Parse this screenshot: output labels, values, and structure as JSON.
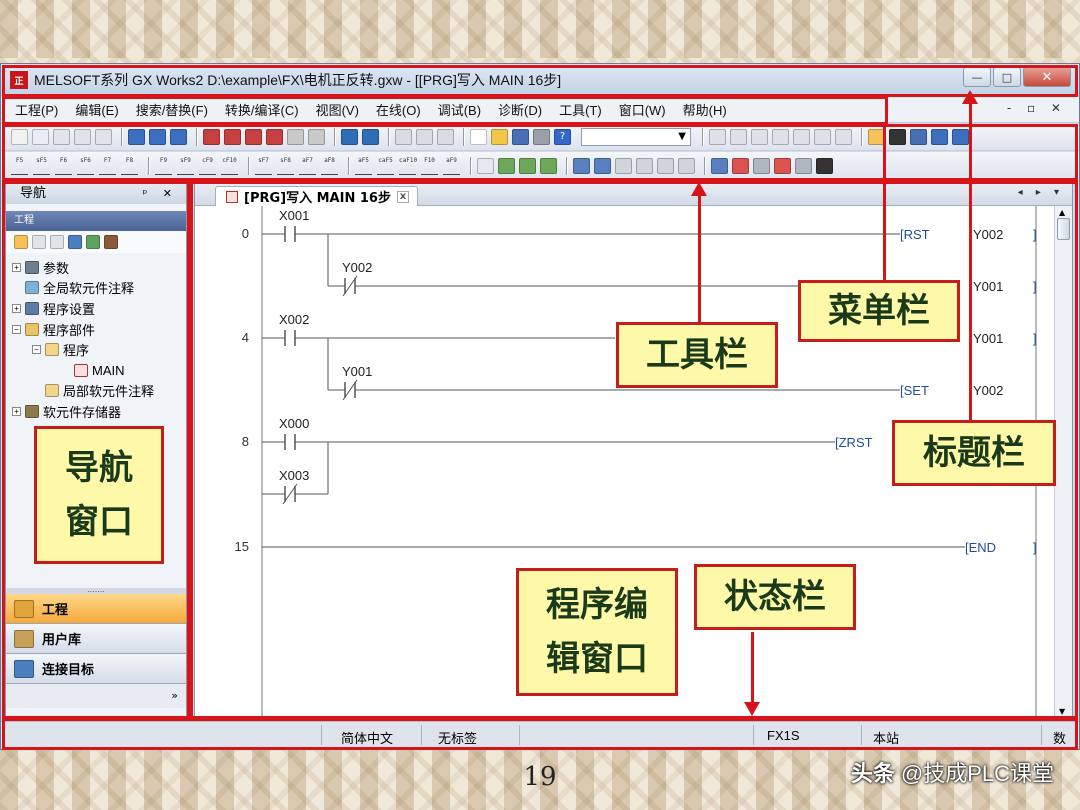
{
  "window": {
    "title": "MELSOFT系列 GX Works2 D:\\example\\FX\\电机正反转.gxw - [[PRG]写入 MAIN 16步]",
    "icon_label": "正",
    "minimize": "—",
    "maximize": "□",
    "close": "✕"
  },
  "menu": {
    "items": [
      "工程(P)",
      "编辑(E)",
      "搜索/替换(F)",
      "转换/编译(C)",
      "视图(V)",
      "在线(O)",
      "调试(B)",
      "诊断(D)",
      "工具(T)",
      "窗口(W)",
      "帮助(H)"
    ],
    "mdi_controls": "- ▫ ✕"
  },
  "toolbar": {
    "ladder_labels": [
      "F5",
      "sF5",
      "F6",
      "sF6",
      "F7",
      "F8",
      "F9",
      "sF9",
      "cF9",
      "cF10",
      "sF7",
      "sF8",
      "aF7",
      "aF8",
      "aF5",
      "caF5",
      "caF10",
      "F10",
      "aF9"
    ],
    "dropdown_value": "▼",
    "help_icon": "?"
  },
  "navigation": {
    "header": "导航",
    "header_controls": "ᵖ ✕",
    "section": "工程",
    "tree": [
      {
        "label": "参数",
        "level": 0,
        "exp": "+"
      },
      {
        "label": "全局软元件注释",
        "level": 0,
        "exp": ""
      },
      {
        "label": "程序设置",
        "level": 0,
        "exp": "+"
      },
      {
        "label": "程序部件",
        "level": 0,
        "exp": "−"
      },
      {
        "label": "程序",
        "level": 1,
        "exp": "−"
      },
      {
        "label": "MAIN",
        "level": 2,
        "exp": ""
      },
      {
        "label": "局部软元件注释",
        "level": 1,
        "exp": ""
      },
      {
        "label": "软元件存储器",
        "level": 0,
        "exp": "+"
      }
    ],
    "buttons": [
      "工程",
      "用户库",
      "连接目标"
    ],
    "more": "»",
    "splitter": "......."
  },
  "editor": {
    "tab_label": "[PRG]写入 MAIN 16步",
    "tab_close": "x",
    "tab_arrows": "◂ ▸ ▾",
    "rungs": [
      {
        "step": "0"
      },
      {
        "step": "4"
      },
      {
        "step": "8"
      },
      {
        "step": "15"
      }
    ],
    "contacts": [
      "X001",
      "Y002",
      "X002",
      "Y001",
      "X000",
      "X003"
    ],
    "instructions": [
      "[RST",
      "[SET",
      "[ZRST",
      "[END"
    ],
    "outputs": [
      "Y002",
      "Y001",
      "Y001",
      "Y002"
    ],
    "bracket": "]"
  },
  "statusbar": {
    "language": "简体中文",
    "label": "无标签",
    "plc": "FX1S",
    "station": "本站",
    "mode": "数"
  },
  "annotations": {
    "menu_bar": "菜单栏",
    "toolbar": "工具栏",
    "title_bar": "标题栏",
    "nav_window": [
      "导航",
      "窗口"
    ],
    "program_editor": [
      "程序编",
      "辑窗口"
    ],
    "status_bar": "状态栏"
  },
  "slide": {
    "page_number": "19",
    "watermark_prefix": "头条",
    "watermark_handle": "@技成PLC课堂"
  },
  "colors": {
    "annotation_red": "#d5151a",
    "callout_fill": "#fdf9a8",
    "active_nav": "#f6a93b"
  }
}
